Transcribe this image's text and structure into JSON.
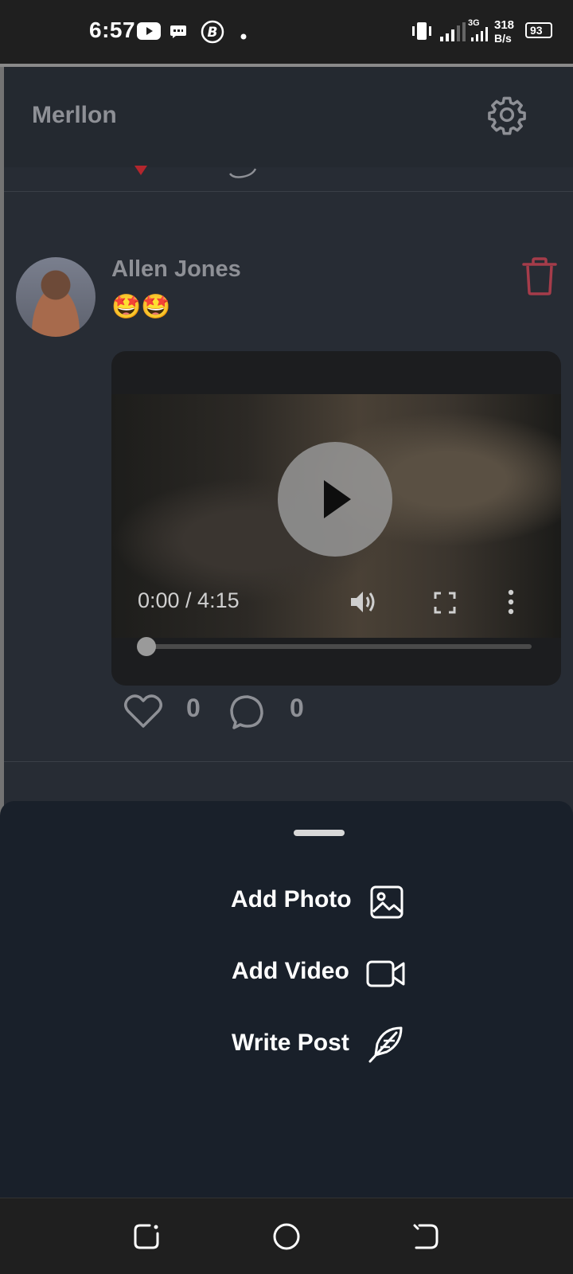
{
  "status_bar": {
    "time": "6:57",
    "net_speed_value": "318",
    "net_speed_unit": "B/s",
    "network_type": "3G",
    "battery": "93"
  },
  "app": {
    "title": "Merllon"
  },
  "post": {
    "author": "Allen Jones",
    "text": "🤩🤩",
    "video": {
      "time": "0:00 / 4:15",
      "progress": 0
    },
    "likes": "0",
    "comments": "0"
  },
  "sheet": {
    "actions": [
      {
        "label": "Add Photo",
        "icon": "image-icon"
      },
      {
        "label": "Add Video",
        "icon": "video-camera-icon"
      },
      {
        "label": "Write Post",
        "icon": "feather-icon"
      }
    ]
  },
  "colors": {
    "app_background": "#272c34",
    "sheet_background": "#19202a",
    "delete_accent": "#a53c4a",
    "muted_text": "#8e9096"
  }
}
